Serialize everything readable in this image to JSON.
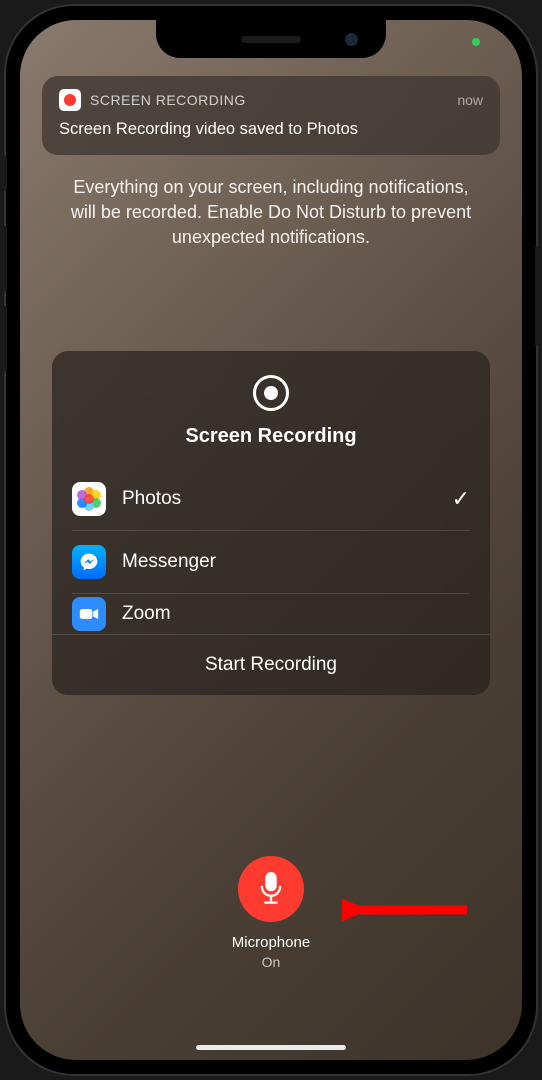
{
  "notification": {
    "app_name": "SCREEN RECORDING",
    "timestamp": "now",
    "message": "Screen Recording video saved to Photos"
  },
  "info_text": "Everything on your screen, including notifications, will be recorded. Enable Do Not Disturb to prevent unexpected notifications.",
  "panel": {
    "title": "Screen Recording",
    "apps": [
      {
        "name": "Photos",
        "selected": true
      },
      {
        "name": "Messenger",
        "selected": false
      },
      {
        "name": "Zoom",
        "selected": false
      }
    ],
    "start_label": "Start Recording"
  },
  "microphone": {
    "label": "Microphone",
    "status": "On",
    "color": "#ff3b30"
  }
}
